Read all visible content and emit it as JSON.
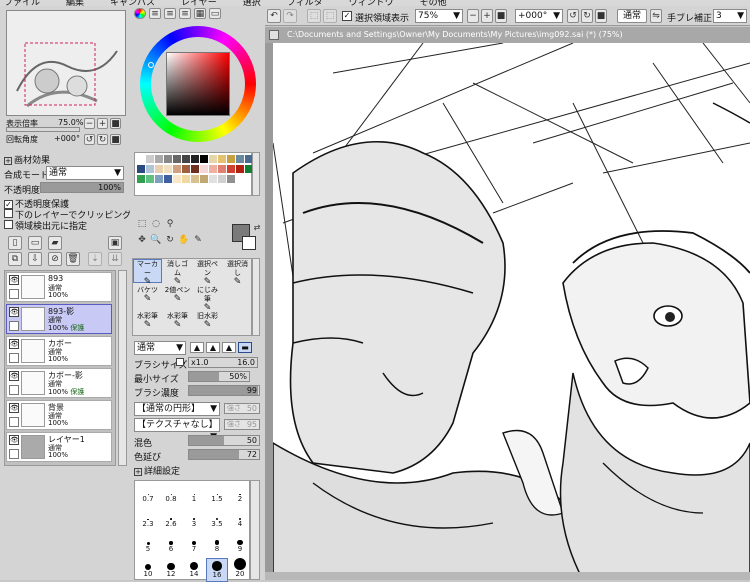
{
  "menu": [
    "ファイル",
    "編集",
    "キャンバス",
    "レイヤー",
    "選択",
    "フィルタ",
    "ウィンドウ",
    "その他"
  ],
  "navigator": {
    "zoom_label": "表示倍率",
    "zoom": "75.0%",
    "angle_label": "回転角度",
    "angle": "+000°"
  },
  "toolbar": {
    "selection_label": "選択領域表示",
    "zoom": "75%",
    "angle": "+000°",
    "mode": "通常",
    "stabilizer_label": "手ブレ補正",
    "stabilizer": "3"
  },
  "canvas_title": "C:\\Documents and Settings\\Owner\\My Documents\\My Pictures\\img092.sai (*) (75%)",
  "effects": {
    "title": "画材効果",
    "blend_label": "合成モード",
    "blend": "通常",
    "opacity_label": "不透明度",
    "opacity": "100%",
    "opacity_fraction": 1.0,
    "preserve_opacity": "不透明度保護",
    "clip": "下のレイヤーでクリッピング",
    "sample": "領域検出元に指定"
  },
  "layers": [
    {
      "name": "893",
      "mode": "通常",
      "opacity": "100%",
      "extra": "",
      "selected": false
    },
    {
      "name": "893-影",
      "mode": "通常",
      "opacity": "100%",
      "extra": "保護",
      "selected": true
    },
    {
      "name": "カボー",
      "mode": "通常",
      "opacity": "100%",
      "extra": "",
      "selected": false
    },
    {
      "name": "カボー-影",
      "mode": "通常",
      "opacity": "100%",
      "extra": "保護",
      "selected": false
    },
    {
      "name": "背景",
      "mode": "通常",
      "opacity": "100%",
      "extra": "",
      "selected": false
    },
    {
      "name": "レイヤー1",
      "mode": "通常",
      "opacity": "100%",
      "extra": "",
      "selected": false
    }
  ],
  "tools": [
    [
      "マーカー",
      "消しゴム",
      "選択ペン",
      "選択消し"
    ],
    [
      "バケツ",
      "2値ペン",
      "にじみ筆",
      ""
    ],
    [
      "水彩筆",
      "水彩筆",
      "旧水彩",
      ""
    ]
  ],
  "tool_sub": [
    "",
    "",
    "1",
    "",
    "",
    "",
    "",
    "",
    "",
    "1水彩",
    "",
    ""
  ],
  "brush": {
    "mode": "通常",
    "size_label": "ブラシサイズ",
    "size_mult": "x1.0",
    "size": "16.0",
    "min_label": "最小サイズ",
    "min": "50%",
    "min_fraction": 0.5,
    "density_label": "ブラシ濃度",
    "density": "99",
    "density_fraction": 0.99,
    "shape": "【通常の円形】",
    "shape_val": "強さ",
    "shape_num": "50",
    "texture": "【テクスチャなし】",
    "texture_val": "強さ",
    "texture_num": "95",
    "blend_label": "混色",
    "blend": "50",
    "blend_fraction": 0.5,
    "dilute_label": "色延び",
    "dilute": "72",
    "dilute_fraction": 0.72,
    "detail_label": "詳細設定"
  },
  "brush_sizes": [
    "0.7",
    "0.8",
    "1",
    "1.5",
    "2",
    "2.3",
    "2.6",
    "3",
    "3.5",
    "4",
    "5",
    "6",
    "7",
    "8",
    "9",
    "10",
    "12",
    "14",
    "16",
    "20"
  ],
  "selected_brush_size": "16",
  "colors": {
    "current": "#7a7a7a",
    "secondary": "#ffffff",
    "hue_ring": "HSV",
    "box": "#cc2222"
  }
}
